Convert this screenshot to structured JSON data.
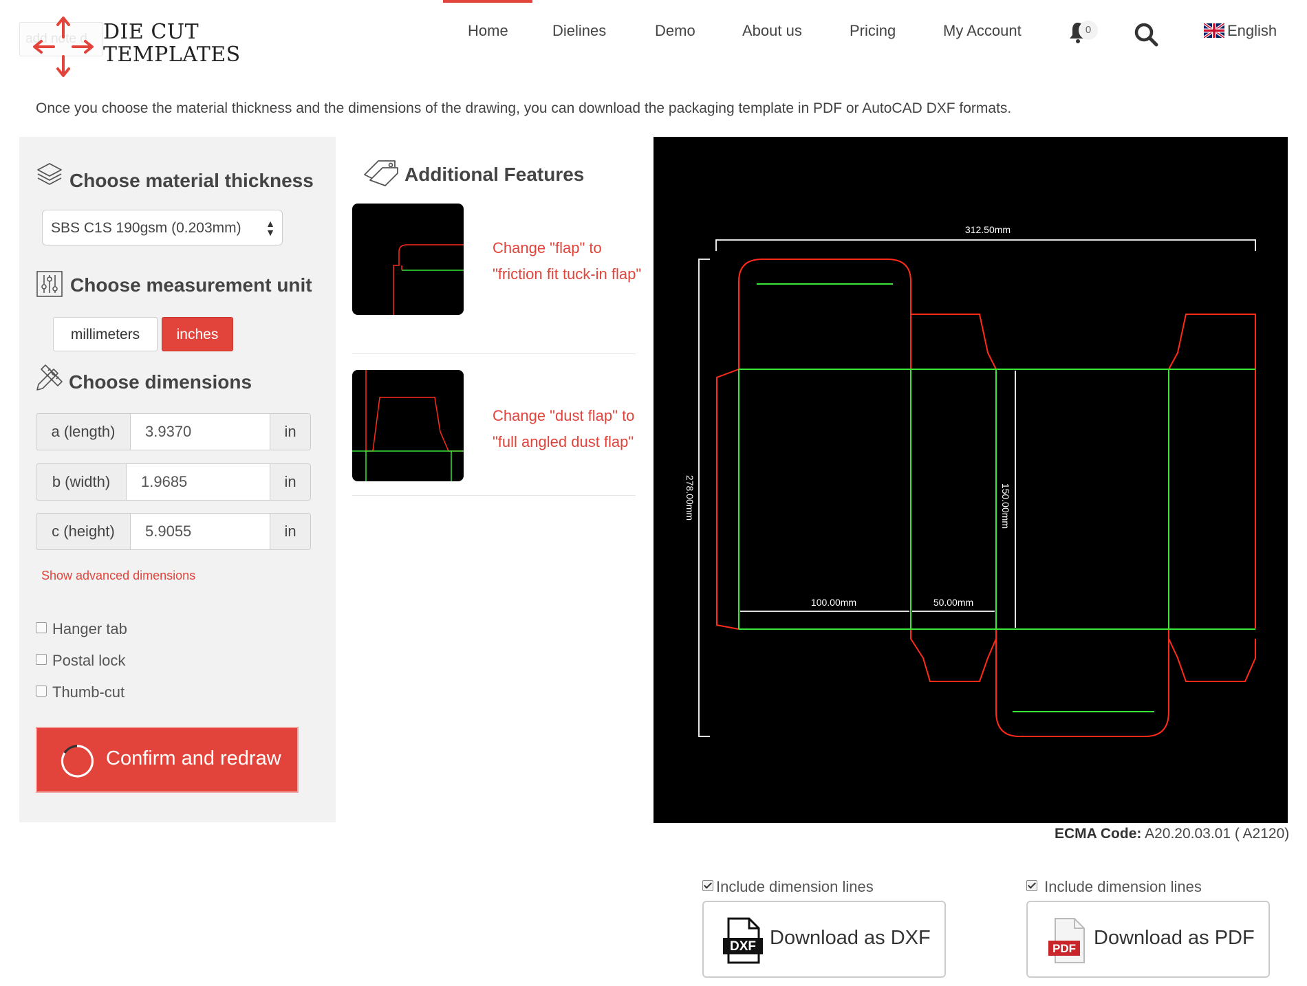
{
  "header": {
    "logo_text_line1": "DIE CUT",
    "logo_text_line2": "TEMPLATES",
    "logo_overlay_text": "add note d",
    "nav": [
      "Home",
      "Dielines",
      "Demo",
      "About us",
      "Pricing",
      "My Account"
    ],
    "active_nav": "Home",
    "notification_count": "0",
    "language": "English",
    "accent_color": "#e2443b"
  },
  "intro": "Once you choose the material thickness and the dimensions of the drawing, you can download the packaging template in PDF or AutoCAD DXF formats.",
  "material": {
    "title": "Choose material thickness",
    "selected": "SBS C1S 190gsm (0.203mm)"
  },
  "unit": {
    "title": "Choose measurement unit",
    "options": [
      "millimeters",
      "inches"
    ],
    "selected": "inches"
  },
  "dimensions": {
    "title": "Choose dimensions",
    "rows": [
      {
        "label": "a (length)",
        "value": "3.9370",
        "unit": "in"
      },
      {
        "label": "b (width)",
        "value": "1.9685",
        "unit": "in"
      },
      {
        "label": "c (height)",
        "value": "5.9055",
        "unit": "in"
      }
    ],
    "advanced_link": "Show advanced dimensions"
  },
  "options": [
    {
      "label": "Hanger tab",
      "checked": false
    },
    {
      "label": "Postal lock",
      "checked": false
    },
    {
      "label": "Thumb-cut",
      "checked": false
    }
  ],
  "confirm_button": "Confirm and redraw",
  "features": {
    "title": "Additional Features",
    "items": [
      {
        "text": "Change \"flap\" to \"friction fit tuck-in flap\""
      },
      {
        "text": "Change \"dust flap\" to \"full angled dust flap\""
      }
    ]
  },
  "drawing": {
    "dim_total_width": "312.50mm",
    "dim_total_height": "278.00mm",
    "dim_height": "150.00mm",
    "dim_length": "100.00mm",
    "dim_width": "50.00mm",
    "cut_color": "#ff2a1a",
    "crease_color": "#39e639"
  },
  "ecma": {
    "label": "ECMA Code:",
    "value": "A20.20.03.01 ( A2120)"
  },
  "downloads": [
    {
      "check_label": "Include dimension lines",
      "checked": true,
      "button": "Download as DXF",
      "icon_text": "DXF"
    },
    {
      "check_label": "Include dimension lines",
      "checked": true,
      "button": "Download as PDF",
      "icon_text": "PDF"
    }
  ]
}
